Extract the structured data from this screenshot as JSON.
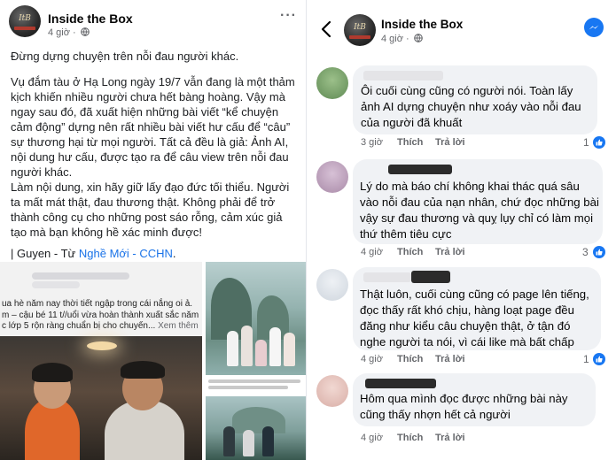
{
  "post": {
    "page_name": "Inside the Box",
    "time": "4 giờ ·",
    "visibility_icon": "globe-icon",
    "more_label": "···",
    "lines": [
      "Đừng dựng chuyện trên nỗi đau người khác."
    ],
    "paragraph1": "Vụ đắm tàu ở Hạ Long ngày 19/7 vẫn đang là một thảm kịch khiến nhiều người chưa hết bàng hoàng. Vậy mà ngay sau đó, đã xuất hiện những bài viết “kể chuyện cảm động” dựng nên rất nhiều bài viết hư cấu để “câu” sự thương hại từ mọi người. Tất cả đều là giả: Ảnh AI, nội dung hư cấu, được tạo ra để câu view trên nỗi đau người khác.",
    "paragraph2": "Làm nội dung, xin hãy giữ lấy đạo đức tối thiểu. Người ta mất mát thật, đau thương thật. Không phải để trở thành công cụ cho những post sáo rỗng, cảm xúc giả tạo mà bạn không hề xác minh được!",
    "signature_prefix": "| Guyen - Từ ",
    "signature_link": "Nghề Mới - CCHN",
    "signature_suffix": ".",
    "shared_snippet": "ua hè năm nay thời tiết ngập trong cái nắng oi ả. m – cậu bé 11 t//uổi vừa hoàn thành xuất sắc năm c lớp 5 rộn ràng chuẩn bị cho chuyến...",
    "shared_more": " Xem thêm"
  },
  "comments_header": {
    "page_name": "Inside the Box",
    "time": "4 giờ ·",
    "back_icon": "chevron-left-icon",
    "messenger_icon": "messenger-icon"
  },
  "comments": [
    {
      "text": "Ôi cuối cùng cũng có người nói. Toàn lấy ảnh AI dựng chuyện như xoáy vào nỗi đau của người đã khuất",
      "time": "3 giờ",
      "like": "Thích",
      "reply": "Trả lời",
      "likes": "1"
    },
    {
      "text": "Lý do mà báo chí không khai thác quá sâu vào nỗi đau của nạn nhân, chứ đọc những bài vậy sự đau thương và quỵ lụy chỉ có làm mọi thứ thêm tiêu cực",
      "time": "4 giờ",
      "like": "Thích",
      "reply": "Trả lời",
      "likes": "3"
    },
    {
      "text": "Thật luôn, cuối cùng cũng có page lên tiếng, đọc thấy rất khó chịu, hàng loạt page đều đăng như kiểu câu chuyện thật, ở tận đó nghe người ta nói, vì cái like mà bất chấp",
      "time": "4 giờ",
      "like": "Thích",
      "reply": "Trả lời",
      "likes": "1"
    },
    {
      "text": "Hôm qua mình đọc được những bài này cũng thấy nhợn hết cả người",
      "time": "4 giờ",
      "like": "Thích",
      "reply": "Trả lời"
    }
  ],
  "colors": {
    "link": "#1a73e8",
    "like_blue": "#1877f2",
    "bubble": "#f0f2f5",
    "meta": "#65676b"
  }
}
